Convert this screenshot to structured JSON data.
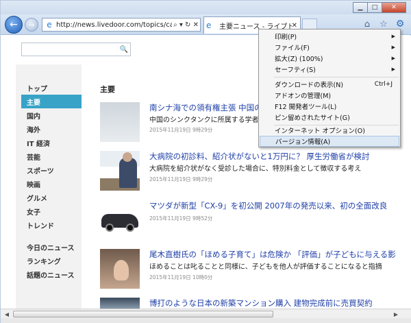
{
  "window": {
    "minimize_glyph": "▁",
    "maximize_glyph": "□",
    "close_glyph": "✕"
  },
  "nav": {
    "back_icon": "arrow-left-icon",
    "forward_icon": "arrow-right-icon",
    "back_glyph": "←",
    "forward_glyph": "→",
    "address": "http://news.livedoor.com/topics/categor",
    "address_controls": "⌕ ▾ ↻ ✕",
    "tab_label": "主要ニュース - ライブド...",
    "tab_close": "✕",
    "home_glyph": "⌂",
    "favorites_glyph": "☆",
    "tools_glyph": "⚙",
    "ie_glyph": "e"
  },
  "search": {
    "value": "",
    "button_glyph": "🔍"
  },
  "sidebar": {
    "items": [
      {
        "label": "トップ"
      },
      {
        "label": "主要"
      },
      {
        "label": "国内"
      },
      {
        "label": "海外"
      },
      {
        "label": "IT 経済"
      },
      {
        "label": "芸能"
      },
      {
        "label": "スポーツ"
      },
      {
        "label": "映画"
      },
      {
        "label": "グルメ"
      },
      {
        "label": "女子"
      },
      {
        "label": "トレンド"
      },
      {
        "label": "今日のニュース"
      },
      {
        "label": "ランキング"
      },
      {
        "label": "話題のニュース"
      }
    ],
    "active_index": 1
  },
  "main": {
    "section_title": "主要",
    "articles": [
      {
        "title": "南シナ海での領有権主張 中国の",
        "desc": "中国のシンクタンクに所属する学者",
        "date": "2015年11月19日 9時29分"
      },
      {
        "title": "大病院の初診料、紹介状がないと1万円に？ 厚生労働省が検討",
        "desc": "大病院を紹介状がなく受診した場合に、特別料金として徴収する考え",
        "date": "2015年11月19日 9時29分"
      },
      {
        "title": "マツダが新型「CX-9」を初公開 2007年の発売以来、初の全面改良",
        "desc": "",
        "date": "2015年11月19日 9時52分"
      },
      {
        "title": "尾木直樹氏の「ほめる子育て」は危険か 「評価」が子どもに与える影",
        "desc": "ほめることは叱ることと同様に、子どもを他人が評価することになると指摘",
        "date": "2015年11月19日 10時0分"
      },
      {
        "title": "博打のような日本の新築マンション購入 建物完成前に売買契約",
        "desc": "",
        "date": ""
      }
    ]
  },
  "menu": {
    "items": [
      {
        "label": "印刷(P)",
        "arrow": "▶"
      },
      {
        "label": "ファイル(F)",
        "arrow": "▶"
      },
      {
        "label": "拡大(Z) (100%)",
        "arrow": "▶"
      },
      {
        "label": "セーフティ(S)",
        "arrow": "▶"
      },
      {
        "label": "ダウンロードの表示(N)",
        "shortcut": "Ctrl+J"
      },
      {
        "label": "アドオンの管理(M)"
      },
      {
        "label": "F12 開発者ツール(L)"
      },
      {
        "label": "ピン留めされたサイト(G)"
      },
      {
        "label": "インターネット オプション(O)"
      },
      {
        "label": "バージョン情報(A)"
      }
    ],
    "highlighted_index": 9
  },
  "scrollbar": {
    "left_glyph": "◀",
    "right_glyph": "▶",
    "grip_glyph": "|||"
  },
  "colors": {
    "accent": "#38a3c7",
    "link": "#2040a8",
    "menu_highlight": "#dde8f5"
  }
}
